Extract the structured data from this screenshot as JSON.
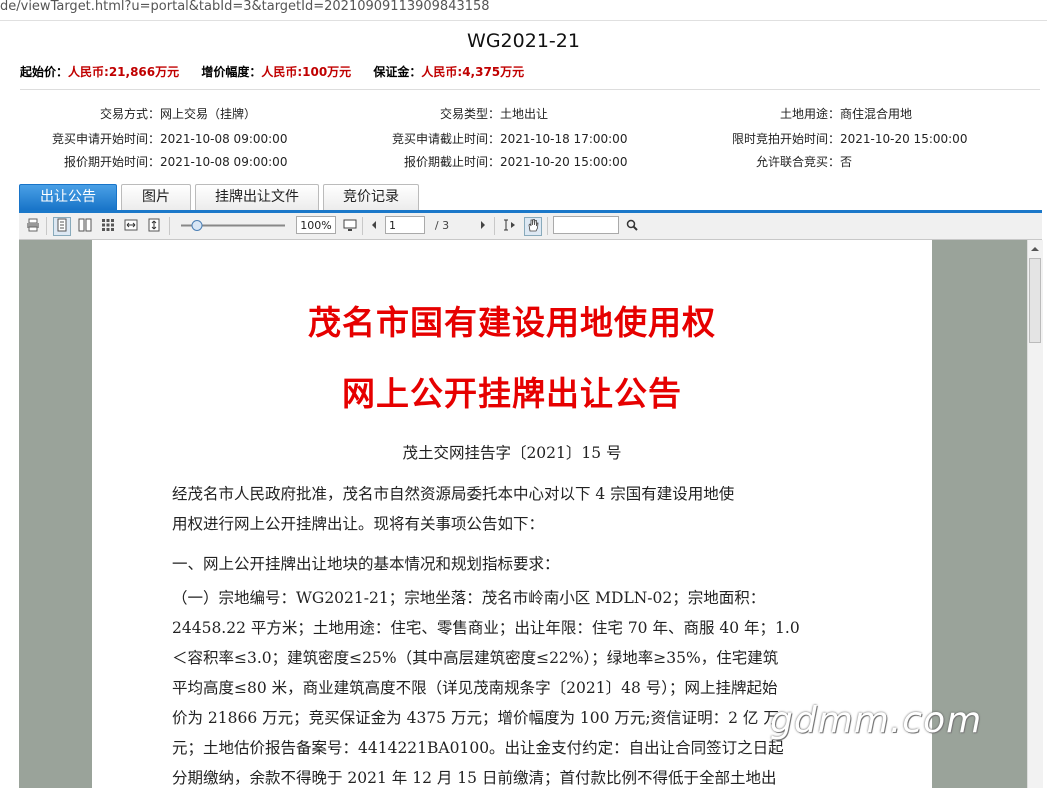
{
  "browser": {
    "url": "de/viewTarget.html?u=portal&tabId=3&targetId=20210909113909843158"
  },
  "header": {
    "title": "WG2021-21",
    "prices": [
      {
        "label": "起始价：",
        "value": "人民币:21,866万元"
      },
      {
        "label": "增价幅度：",
        "value": "人民币:100万元"
      },
      {
        "label": "保证金：",
        "value": "人民币:4,375万元"
      }
    ]
  },
  "info": {
    "trade_method": {
      "label": "交易方式：",
      "value": "网上交易（挂牌）"
    },
    "trade_type": {
      "label": "交易类型：",
      "value": "土地出让"
    },
    "land_use": {
      "label": "土地用途：",
      "value": "商住混合用地"
    },
    "apply_start": {
      "label": "竞买申请开始时间：",
      "value": "2021-10-08 09:00:00"
    },
    "apply_end": {
      "label": "竞买申请截止时间：",
      "value": "2021-10-18 17:00:00"
    },
    "auction_start": {
      "label": "限时竞拍开始时间：",
      "value": "2021-10-20 15:00:00"
    },
    "quote_start": {
      "label": "报价期开始时间：",
      "value": "2021-10-08 09:00:00"
    },
    "quote_end": {
      "label": "报价期截止时间：",
      "value": "2021-10-20 15:00:00"
    },
    "joint_bid": {
      "label": "允许联合竞买：",
      "value": "否"
    }
  },
  "tabs": [
    {
      "label": "出让公告",
      "active": true
    },
    {
      "label": "图片",
      "active": false
    },
    {
      "label": "挂牌出让文件",
      "active": false
    },
    {
      "label": "竞价记录",
      "active": false
    }
  ],
  "toolbar": {
    "zoom": "100%",
    "page_current": "1",
    "page_total": "/ 3",
    "search_value": "",
    "icons": [
      "print-icon",
      "single-page-icon",
      "two-page-icon",
      "grid-icon",
      "fit-width-icon",
      "fit-height-icon",
      "zoom-slider",
      "fullscreen-icon",
      "prev-page-icon",
      "next-page-icon",
      "text-select-icon",
      "hand-tool-icon",
      "search-icon"
    ]
  },
  "document": {
    "title_line1": "茂名市国有建设用地使用权",
    "title_line2": "网上公开挂牌出让公告",
    "doc_number": "茂土交网挂告字〔2021〕15 号",
    "lines": [
      "    经茂名市人民政府批准，茂名市自然资源局委托本中心对以下 4 宗国有建设用地使",
      "用权进行网上公开挂牌出让。现将有关事项公告如下：",
      "    一、网上公开挂牌出让地块的基本情况和规划指标要求：",
      "    （一）宗地编号：WG2021-21；宗地坐落：茂名市岭南小区 MDLN-02；宗地面积：",
      "24458.22 平方米；土地用途：住宅、零售商业；出让年限：住宅 70 年、商服 40 年；1.0",
      "＜容积率≤3.0；建筑密度≤25%（其中高层建筑密度≤22%）；绿地率≥35%，住宅建筑",
      "平均高度≤80 米，商业建筑高度不限（详见茂南规条字〔2021〕48 号）；网上挂牌起始",
      "价为 21866 万元；竞买保证金为 4375 万元；增价幅度为 100 万元;资信证明：2 亿 万",
      "元；土地估价报告备案号：4414221BA0100。出让金支付约定：自出让合同签订之日起",
      "分期缴纳，余款不得晚于 2021 年 12 月 15 日前缴清；首付款比例不得低于全部土地出"
    ]
  },
  "watermark": "gdmm.com"
}
